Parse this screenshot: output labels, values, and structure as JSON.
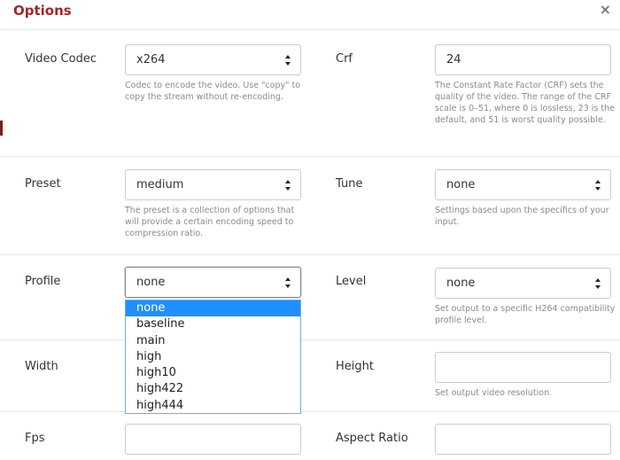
{
  "header": {
    "title": "Options",
    "close_glyph": "×"
  },
  "fields": {
    "video_codec": {
      "label": "Video Codec",
      "value": "x264",
      "help": "Codec to encode the video. Use \"copy\" to copy the stream without re-encoding."
    },
    "crf": {
      "label": "Crf",
      "value": "24",
      "help": "The Constant Rate Factor (CRF) sets the quality of the video. The range of the CRF scale is 0–51, where 0 is lossless, 23 is the default, and 51 is worst quality possible."
    },
    "preset": {
      "label": "Preset",
      "value": "medium",
      "help": "The preset is a collection of options that will provide a certain encoding speed to compression ratio."
    },
    "tune": {
      "label": "Tune",
      "value": "none",
      "help": "Settings based upon the specifics of your input."
    },
    "profile": {
      "label": "Profile",
      "value": "none",
      "options": [
        "none",
        "baseline",
        "main",
        "high",
        "high10",
        "high422",
        "high444"
      ]
    },
    "level": {
      "label": "Level",
      "value": "none",
      "help": "Set output to a specific H264 compatibility profile level."
    },
    "width": {
      "label": "Width",
      "value": ""
    },
    "height": {
      "label": "Height",
      "value": "",
      "help": "Set output video resolution."
    },
    "fps": {
      "label": "Fps",
      "value": ""
    },
    "aspect_ratio": {
      "label": "Aspect Ratio",
      "value": ""
    }
  },
  "icons": {
    "caret": "select-caret-icon"
  },
  "colors": {
    "title": "#9b2b2b",
    "selected_option": "#1e90ff"
  }
}
